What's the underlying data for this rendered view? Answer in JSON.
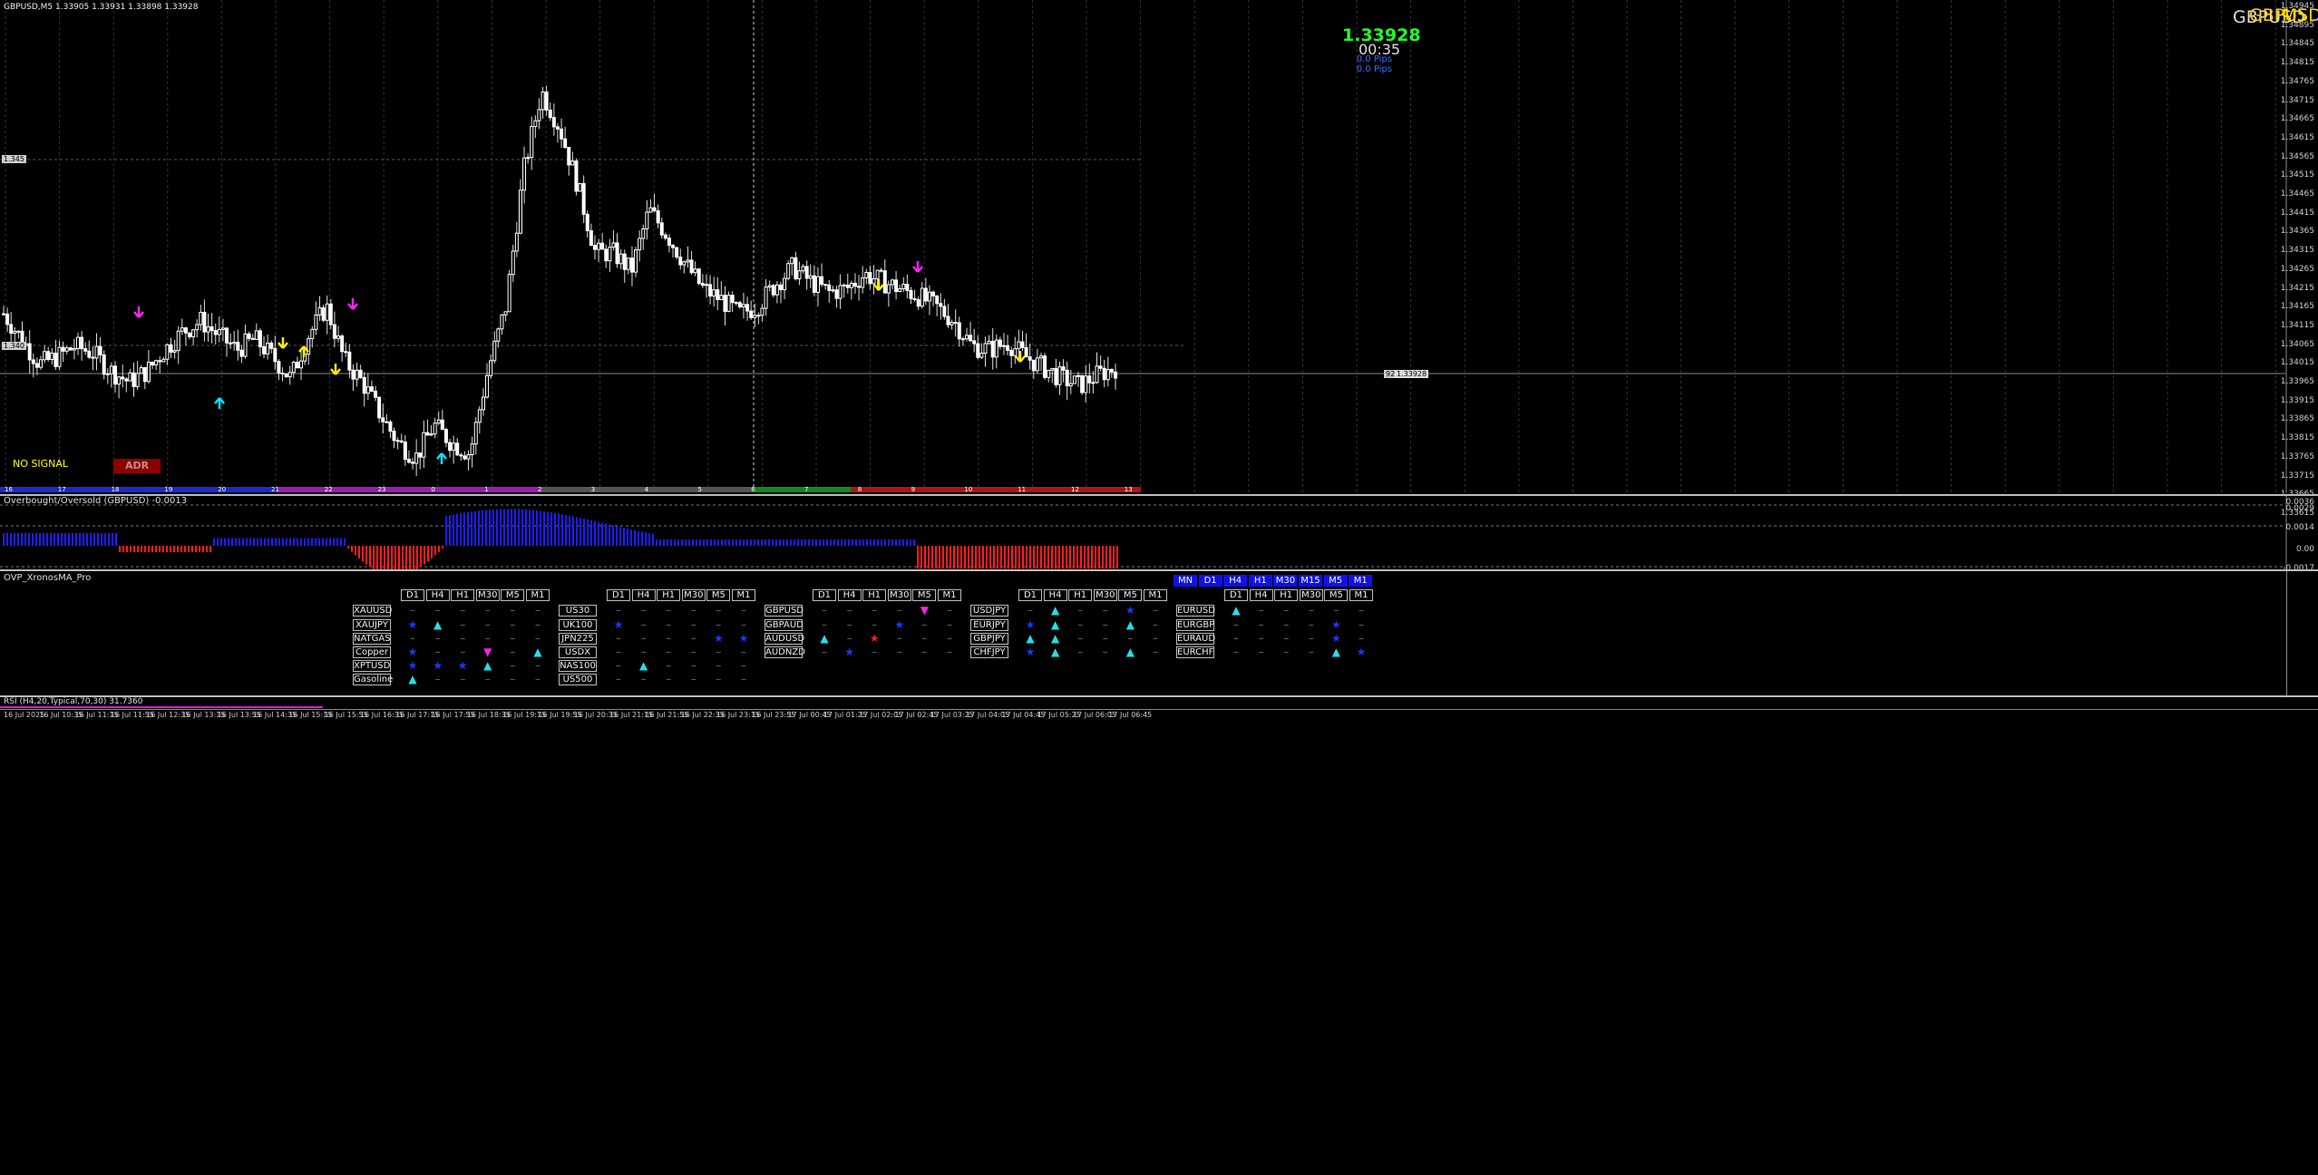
{
  "chart": {
    "title": "GBPUSD,M5  1.33905 1.33931 1.33898 1.33928",
    "symbol_overlay_1": "GBPUSD",
    "symbol_overlay_2": "GBPUSD",
    "tf_overlay": "M5",
    "price_big": "1.33928",
    "timer": "00:35",
    "pips_1": "0.0 Pips",
    "pips_2": "0.0 Pips",
    "no_signal": "NO SIGNAL",
    "adr_label": "ADR",
    "level_1345": "1.345",
    "level_1340": "1.340",
    "current_price_tag": "1.33928",
    "current_small_tag": "92.3",
    "y_axis": [
      "1.34945",
      "1.34895",
      "1.34845",
      "1.34815",
      "1.34765",
      "1.34715",
      "1.34665",
      "1.34615",
      "1.34565",
      "1.34515",
      "1.34465",
      "1.34415",
      "1.34365",
      "1.34315",
      "1.34265",
      "1.34215",
      "1.34165",
      "1.34115",
      "1.34065",
      "1.34015",
      "1.33965",
      "1.33915",
      "1.33865",
      "1.33815",
      "1.33765",
      "1.33715",
      "1.33665",
      "1.33615"
    ],
    "session_hours": [
      "16",
      "17",
      "18",
      "19",
      "20",
      "21",
      "22",
      "23",
      "0",
      "1",
      "2",
      "3",
      "4",
      "5",
      "6",
      "7",
      "8",
      "9",
      "10",
      "11",
      "12",
      "13"
    ],
    "colors": {
      "session_blue": "#1a2bd0",
      "session_purple": "#9a1fb0",
      "session_gray": "#555555",
      "session_green": "#0f8a1f",
      "session_red": "#b01515",
      "up_arrow": "#00e5ff",
      "down_arrow_magenta": "#ff22ff",
      "yellow_arrow": "#ffee00"
    }
  },
  "osc": {
    "label": "Overbought/Oversold (GBPUSD) -0.0013",
    "y_axis": [
      "0.0036",
      "0.0029",
      "0.0014",
      "0.00",
      "-0.0017"
    ]
  },
  "xronos": {
    "label": "OVP_XronosMA_Pro",
    "tf_headers": [
      "D1",
      "H4",
      "H1",
      "M30",
      "M5",
      "M1"
    ],
    "top_tfs": [
      "MN",
      "D1",
      "H4",
      "H1",
      "M30",
      "M15",
      "M5",
      "M1"
    ],
    "groups": [
      {
        "symbols": [
          "XAUUSD",
          "XAUJPY",
          "NATGAS",
          "Copper",
          "XPTUSD",
          "Gasoline"
        ],
        "cells": [
          [
            "-",
            "-",
            "-",
            "-",
            "-",
            "-"
          ],
          [
            "star",
            "up",
            "-",
            "-",
            "-",
            "-"
          ],
          [
            "-",
            "-",
            "-",
            "-",
            "-",
            "-"
          ],
          [
            "star",
            "-",
            "-",
            "down",
            "-",
            "up"
          ],
          [
            "star",
            "star",
            "star",
            "up",
            "-",
            "-"
          ],
          [
            "up",
            "-",
            "-",
            "-",
            "-",
            "-"
          ]
        ]
      },
      {
        "symbols": [
          "US30",
          "UK100",
          "JPN225",
          "USDX",
          "NAS100",
          "US500"
        ],
        "cells": [
          [
            "-",
            "-",
            "-",
            "-",
            "-",
            "-"
          ],
          [
            "star",
            "-",
            "-",
            "-",
            "-",
            "-"
          ],
          [
            "-",
            "-",
            "-",
            "-",
            "star",
            "star"
          ],
          [
            "-",
            "-",
            "-",
            "-",
            "-",
            "-"
          ],
          [
            "-",
            "up",
            "-",
            "-",
            "-",
            "-"
          ],
          [
            "-",
            "-",
            "-",
            "-",
            "-",
            "-"
          ]
        ]
      },
      {
        "symbols": [
          "GBPUSD",
          "GBPAUD",
          "AUDUSD",
          "AUDNZD"
        ],
        "cells": [
          [
            "-",
            "-",
            "-",
            "-",
            "down",
            "-"
          ],
          [
            "-",
            "-",
            "-",
            "star",
            "-",
            "-"
          ],
          [
            "up",
            "-",
            "redstar",
            "-",
            "-",
            "-"
          ],
          [
            "-",
            "star",
            "-",
            "-",
            "-",
            "-"
          ]
        ]
      },
      {
        "symbols": [
          "USDJPY",
          "EURJPY",
          "GBPJPY",
          "CHFJPY"
        ],
        "cells": [
          [
            "-",
            "up",
            "-",
            "-",
            "star",
            "-"
          ],
          [
            "star",
            "up",
            "-",
            "-",
            "up",
            "-"
          ],
          [
            "up",
            "up",
            "-",
            "-",
            "-",
            "-"
          ],
          [
            "star",
            "up",
            "-",
            "-",
            "up",
            "-"
          ]
        ]
      },
      {
        "symbols": [
          "EURUSD",
          "EURGBP",
          "EURAUD",
          "EURCHF"
        ],
        "cells": [
          [
            "up",
            "-",
            "-",
            "-",
            "-",
            "-"
          ],
          [
            "-",
            "-",
            "-",
            "-",
            "star",
            "-"
          ],
          [
            "-",
            "-",
            "-",
            "-",
            "star",
            "-"
          ],
          [
            "-",
            "-",
            "-",
            "-",
            "up",
            "star",
            "star"
          ]
        ]
      }
    ]
  },
  "rsi": {
    "label": "RSI (H4,20,Typical,70,30) 31.7360"
  },
  "x_axis": [
    "16 Jul 2025",
    "16 Jul 10:35",
    "16 Jul 11:15",
    "16 Jul 11:55",
    "16 Jul 12:35",
    "16 Jul 13:15",
    "16 Jul 13:55",
    "16 Jul 14:35",
    "16 Jul 15:15",
    "16 Jul 15:55",
    "16 Jul 16:35",
    "16 Jul 17:15",
    "16 Jul 17:55",
    "16 Jul 18:35",
    "16 Jul 19:15",
    "16 Jul 19:55",
    "16 Jul 20:35",
    "16 Jul 21:15",
    "16 Jul 21:55",
    "16 Jul 22:35",
    "16 Jul 23:15",
    "16 Jul 23:55",
    "17 Jul 00:45",
    "17 Jul 01:25",
    "17 Jul 02:05",
    "17 Jul 02:45",
    "17 Jul 03:25",
    "17 Jul 04:05",
    "17 Jul 04:45",
    "17 Jul 05:25",
    "17 Jul 06:05",
    "17 Jul 06:45"
  ],
  "chart_data": {
    "type": "line",
    "title": "GBPUSD,M5",
    "ylim": [
      1.33615,
      1.34945
    ],
    "close_path": [
      1.3408,
      1.3401,
      1.3394,
      1.3396,
      1.3399,
      1.3397,
      1.3392,
      1.3389,
      1.3392,
      1.3398,
      1.3403,
      1.3406,
      1.3402,
      1.3398,
      1.3401,
      1.3396,
      1.339,
      1.3402,
      1.341,
      1.3395,
      1.3389,
      1.338,
      1.3372,
      1.3368,
      1.3377,
      1.3372,
      1.3369,
      1.3392,
      1.341,
      1.3448,
      1.347,
      1.346,
      1.3444,
      1.3425,
      1.3425,
      1.342,
      1.3437,
      1.343,
      1.3422,
      1.3415,
      1.3412,
      1.3408,
      1.341,
      1.3416,
      1.3421,
      1.3417,
      1.3414,
      1.3415,
      1.3419,
      1.3417,
      1.3415,
      1.3413,
      1.341,
      1.3406,
      1.3399,
      1.3398,
      1.34,
      1.3396,
      1.3393,
      1.339,
      1.3388,
      1.3391,
      1.3393
    ]
  }
}
